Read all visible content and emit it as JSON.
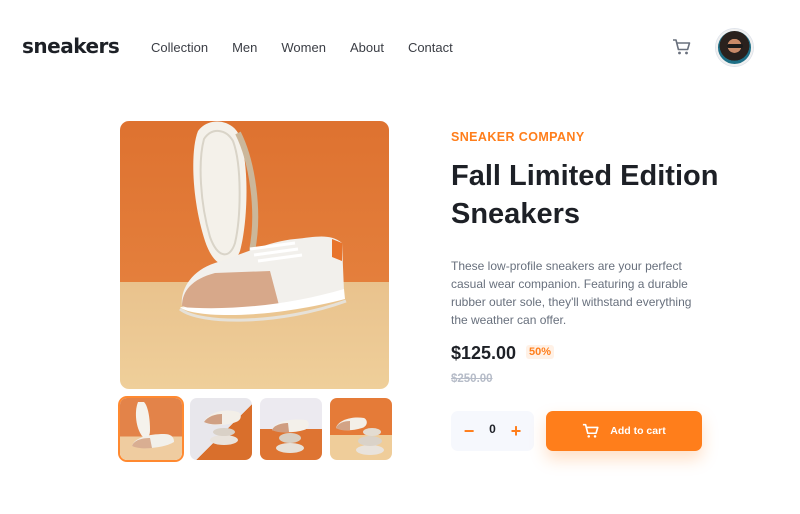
{
  "header": {
    "logo": "sneakers",
    "nav": [
      "Collection",
      "Men",
      "Women",
      "About",
      "Contact"
    ],
    "cart_icon": "cart-icon",
    "avatar": "user-avatar"
  },
  "product": {
    "company": "SNEAKER COMPANY",
    "title": "Fall Limited Edition Sneakers",
    "description": "These low-profile sneakers are your perfect casual wear companion. Featuring a durable rubber outer sole, they'll withstand everything the weather can offer.",
    "price": "$125.00",
    "discount": "50%",
    "original_price": "$250.00"
  },
  "cart_controls": {
    "minus": "−",
    "quantity": "0",
    "plus": "+",
    "add_to_cart": "Add to cart"
  },
  "colors": {
    "accent": "#ff7e1b",
    "dark": "#1d2026",
    "muted": "#68707d",
    "pale": "#b6bcc8"
  }
}
